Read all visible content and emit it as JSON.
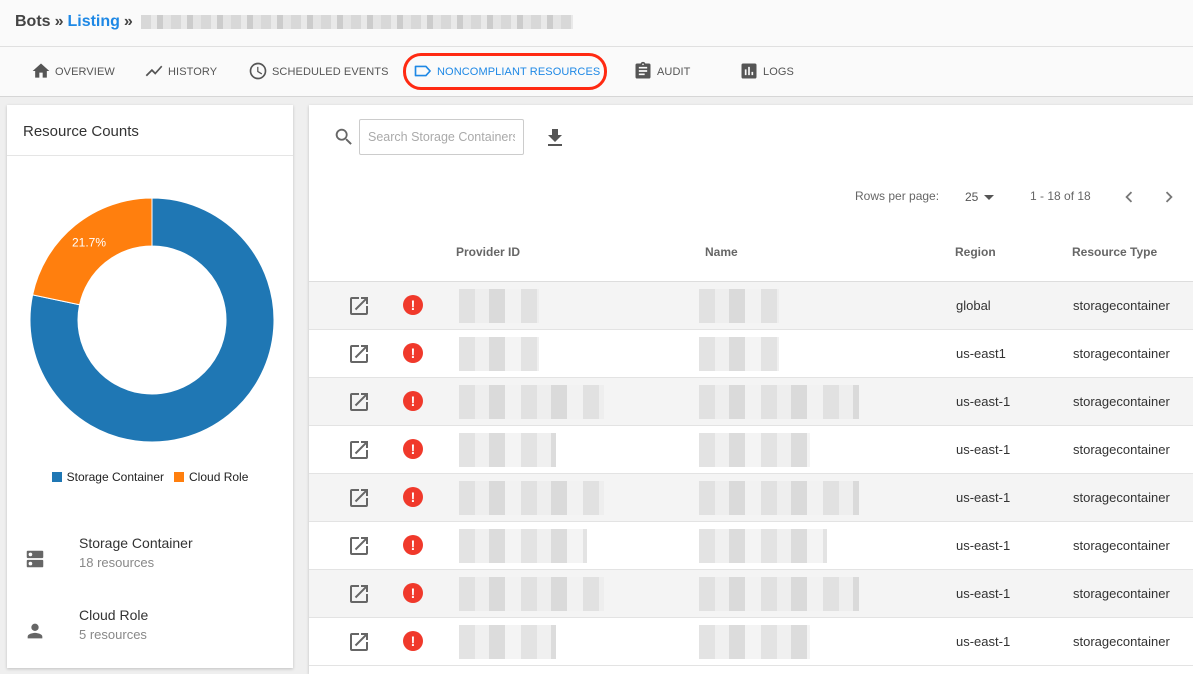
{
  "breadcrumb": {
    "root": "Bots",
    "sep1": "»",
    "link": "Listing",
    "sep2": "»"
  },
  "tabs": [
    {
      "label": "OVERVIEW",
      "icon": "home-icon"
    },
    {
      "label": "HISTORY",
      "icon": "trend-line-icon"
    },
    {
      "label": "SCHEDULED EVENTS",
      "icon": "clock-icon"
    },
    {
      "label": "NONCOMPLIANT RESOURCES",
      "icon": "label-tag-icon",
      "active": true
    },
    {
      "label": "AUDIT",
      "icon": "clipboard-icon"
    },
    {
      "label": "LOGS",
      "icon": "bar-chart-icon"
    }
  ],
  "left_card": {
    "title": "Resource Counts",
    "chart_data": {
      "type": "pie",
      "categories": [
        "Storage Container",
        "Cloud Role"
      ],
      "values": [
        78.3,
        21.7
      ],
      "labels": [
        "78.3%",
        "21.7%"
      ],
      "colors": [
        "#1f77b4",
        "#ff7f0e"
      ],
      "legend_position": "bottom"
    },
    "resources": [
      {
        "name": "Storage Container",
        "count": "18 resources",
        "icon": "server-icon"
      },
      {
        "name": "Cloud Role",
        "count": "5 resources",
        "icon": "person-icon"
      }
    ]
  },
  "table": {
    "search_placeholder": "Search Storage Containers",
    "rows_per_page_label": "Rows per page:",
    "rows_per_page_value": "25",
    "range": "1 - 18 of 18",
    "headers": {
      "provider_id": "Provider ID",
      "name": "Name",
      "region": "Region",
      "resource_type": "Resource Type"
    },
    "rows": [
      {
        "region": "global",
        "type": "storagecontainer"
      },
      {
        "region": "us-east1",
        "type": "storagecontainer"
      },
      {
        "region": "us-east-1",
        "type": "storagecontainer"
      },
      {
        "region": "us-east-1",
        "type": "storagecontainer"
      },
      {
        "region": "us-east-1",
        "type": "storagecontainer"
      },
      {
        "region": "us-east-1",
        "type": "storagecontainer"
      },
      {
        "region": "us-east-1",
        "type": "storagecontainer"
      },
      {
        "region": "us-east-1",
        "type": "storagecontainer"
      }
    ]
  },
  "colors": {
    "accent": "#1e88e5",
    "alert": "#f0392b",
    "highlight": "#ff2a12"
  }
}
